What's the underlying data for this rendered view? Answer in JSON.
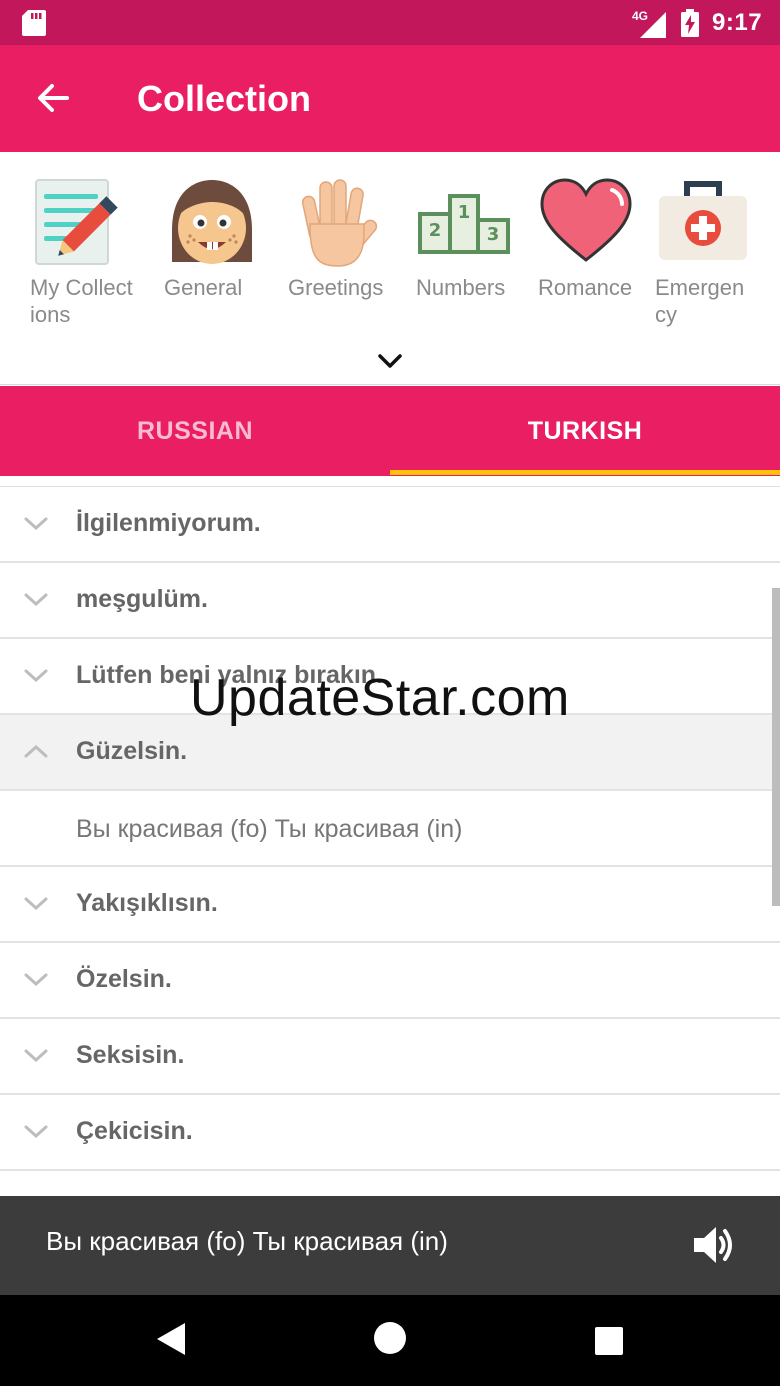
{
  "status_bar": {
    "network_label": "4G",
    "time": "9:17",
    "icons": [
      "sd-card-icon",
      "signal-icon",
      "battery-charging-icon"
    ]
  },
  "app_bar": {
    "title": "Collection",
    "back_icon": "arrow-back-icon"
  },
  "categories": {
    "items": [
      {
        "label": "My Collect\nions",
        "icon": "notepad-pencil-icon"
      },
      {
        "label": "General",
        "icon": "cartoon-face-icon"
      },
      {
        "label": "Greetings",
        "icon": "waving-hand-icon"
      },
      {
        "label": "Numbers",
        "icon": "podium-numbers-icon"
      },
      {
        "label": "Romance",
        "icon": "heart-icon"
      },
      {
        "label": "Emergen\ncy",
        "icon": "first-aid-kit-icon"
      }
    ],
    "expand_icon": "chevron-down-icon"
  },
  "tabs": {
    "items": [
      {
        "label": "RUSSIAN",
        "selected": false
      },
      {
        "label": "TURKISH",
        "selected": true
      }
    ],
    "indicator_color": "#ffc107"
  },
  "phrases": [
    {
      "text": "İlgilenmiyorum.",
      "expanded": false
    },
    {
      "text": "meşgulüm.",
      "expanded": false
    },
    {
      "text": "Lütfen beni yalnız bırakın.",
      "expanded": false
    },
    {
      "text": "Güzelsin.",
      "expanded": true,
      "translation": "Вы красивая (fo)  Ты красивая (in)"
    },
    {
      "text": "Yakışıklısın.",
      "expanded": false
    },
    {
      "text": "Özelsin.",
      "expanded": false
    },
    {
      "text": "Seksisin.",
      "expanded": false
    },
    {
      "text": "Çekicisin.",
      "expanded": false
    }
  ],
  "watermark": "UpdateStar.com",
  "player": {
    "text": "Вы красивая (fo)  Ты красивая (in)",
    "icon": "speaker-icon"
  },
  "nav_bar": {
    "icons": [
      "nav-back-icon",
      "nav-home-icon",
      "nav-recents-icon"
    ]
  },
  "colors": {
    "status_bar": "#c2185b",
    "primary": "#e91e63",
    "player_bar": "#3c3c3c",
    "tab_indicator": "#ffc107"
  }
}
